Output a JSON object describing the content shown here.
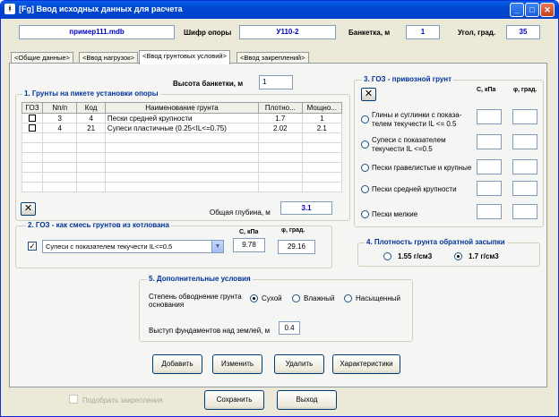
{
  "window": {
    "title": "[Fg] Ввод исходных данных для расчета",
    "app_icon_glyph": "ᚼ",
    "minimize_glyph": "_",
    "maximize_glyph": "□",
    "close_glyph": "✕"
  },
  "header": {
    "file_name": "пример111.mdb",
    "support_code_label": "Шифр опоры",
    "support_code": "У110-2",
    "banquette_label": "Банкетка, м",
    "banquette_value": "1",
    "angle_label": "Угол, град.",
    "angle_value": "35"
  },
  "tabs": [
    {
      "label": "<Общие данные>",
      "active": false
    },
    {
      "label": "<Ввод нагрузок>",
      "active": false
    },
    {
      "label": "<Ввод грунтовых условий>",
      "active": true
    },
    {
      "label": "<Ввод закреплений>",
      "active": false
    }
  ],
  "banquette_height": {
    "label": "Высота банкетки, м",
    "value": "1"
  },
  "group1": {
    "title": "1.  Грунты на пикете установки опоры",
    "columns": [
      "ГОЗ",
      "Nп/п",
      "Код",
      "Наименование грунта",
      "Плотно...",
      "Мощно..."
    ],
    "rows": [
      {
        "goz": false,
        "num": "3",
        "code": "4",
        "name": "Пески средней крупности",
        "density": "1.7",
        "thickness": "1"
      },
      {
        "goz": false,
        "num": "4",
        "code": "21",
        "name": "Супеси пластичные (0.25<IL<=0.75)",
        "density": "2.02",
        "thickness": "2.1"
      }
    ],
    "empty_rows": 6,
    "delete_glyph": "✕",
    "total_depth_label": "Общая глубина, м",
    "total_depth_value": "3.1"
  },
  "group2": {
    "title": "2.  ГОЗ - как смесь грунтов из котлована",
    "checkbox_checked": true,
    "check_glyph": "✓",
    "soil_selected": "Супеси с показателем текучести IL<=0.5",
    "dropdown_glyph": "▼",
    "c_label": "С, кПа",
    "c_value": "9.78",
    "phi_label": "φ, град.",
    "phi_value": "29.16"
  },
  "group3": {
    "title": "3. ГОЗ - привозной грунт",
    "clear_glyph": "✕",
    "c_label": "С, кПа",
    "phi_label": "φ, град.",
    "options": [
      "Глины и суглинки с показа-\nтелем текучести IL <= 0.5",
      "Супеси с показателем\nтекучести IL <=0.5",
      "Пески гравелистые и крупные",
      "Пески  средней крупности",
      "Пески мелкие"
    ]
  },
  "group4": {
    "title": "4. Плотность грунта обратной засыпки",
    "options": [
      {
        "label": "1.55 г/см3",
        "selected": false
      },
      {
        "label": "1.7 г/см3",
        "selected": true
      }
    ]
  },
  "group5": {
    "title": "5.  Дополнительные условия",
    "water_label_line1": "Степень обводнение грунта",
    "water_label_line2": "основания",
    "water_options": [
      {
        "label": "Сухой",
        "selected": true
      },
      {
        "label": "Влажный",
        "selected": false
      },
      {
        "label": "Насыщенный",
        "selected": false
      }
    ],
    "foundation_label": "Выступ фундаментов над землей, м",
    "foundation_value": "0.4"
  },
  "actions": {
    "add": "Добавить",
    "edit": "Изменить",
    "delete": "Удалить",
    "properties": "Характеристики"
  },
  "footer": {
    "pick_label": "Подобрать закрепления",
    "pick_checked": false,
    "save": "Сохранить",
    "exit": "Выход"
  }
}
